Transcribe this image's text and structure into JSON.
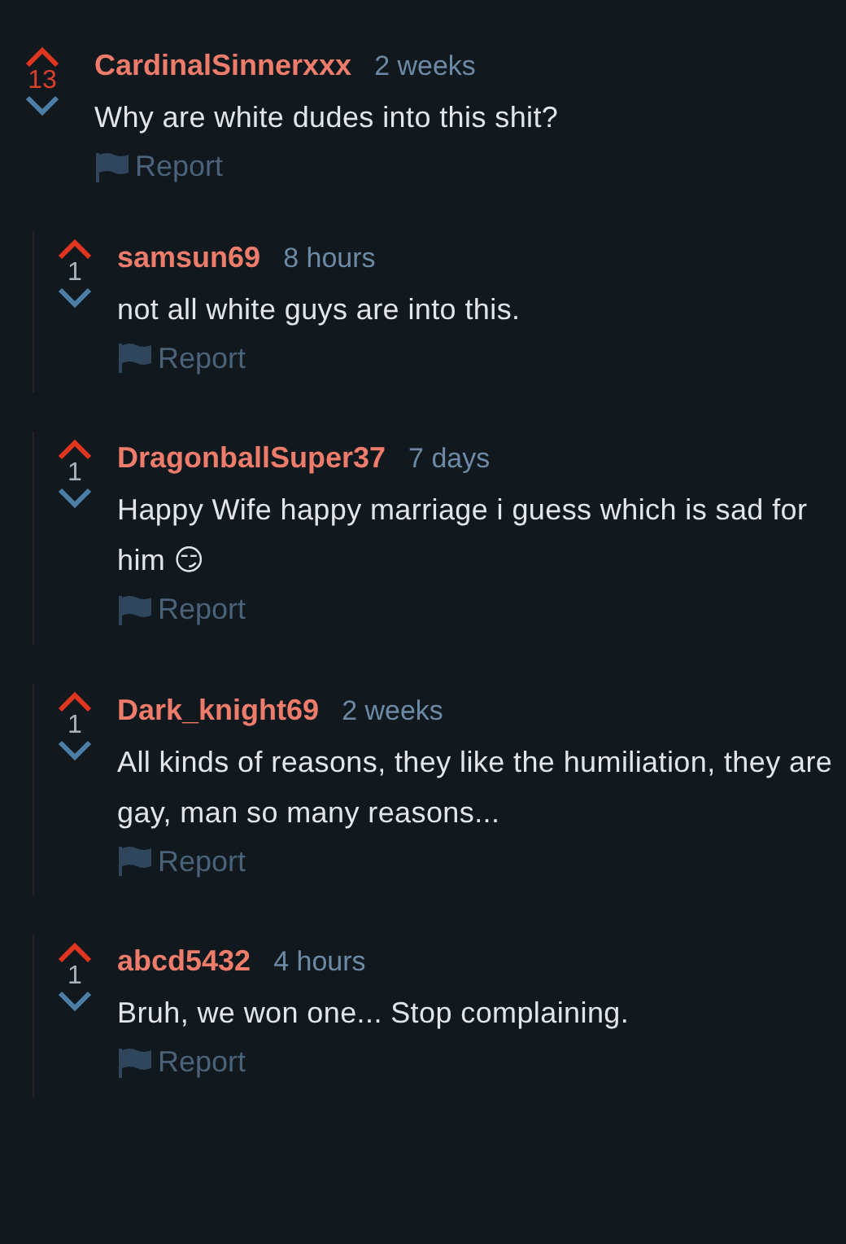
{
  "comments": [
    {
      "author": "CardinalSinnerxxx",
      "time": "2 weeks",
      "score": "13",
      "text": "Why are white dudes into this shit?",
      "report": "Report",
      "children": [
        {
          "author": "samsun69",
          "time": "8 hours",
          "score": "1",
          "text": "not all white guys are into this.",
          "report": "Report"
        },
        {
          "author": "DragonballSuper37",
          "time": "7 days",
          "score": "1",
          "text": "Happy Wife happy marriage i guess which is sad for him 😏",
          "report": "Report"
        },
        {
          "author": "Dark_knight69",
          "time": "2 weeks",
          "score": "1",
          "text": "All kinds of reasons, they like the humiliation, they are gay, man so many reasons...",
          "report": "Report"
        },
        {
          "author": "abcd5432",
          "time": "4 hours",
          "score": "1",
          "text": "Bruh, we won one... Stop complaining.",
          "report": "Report"
        }
      ]
    }
  ]
}
